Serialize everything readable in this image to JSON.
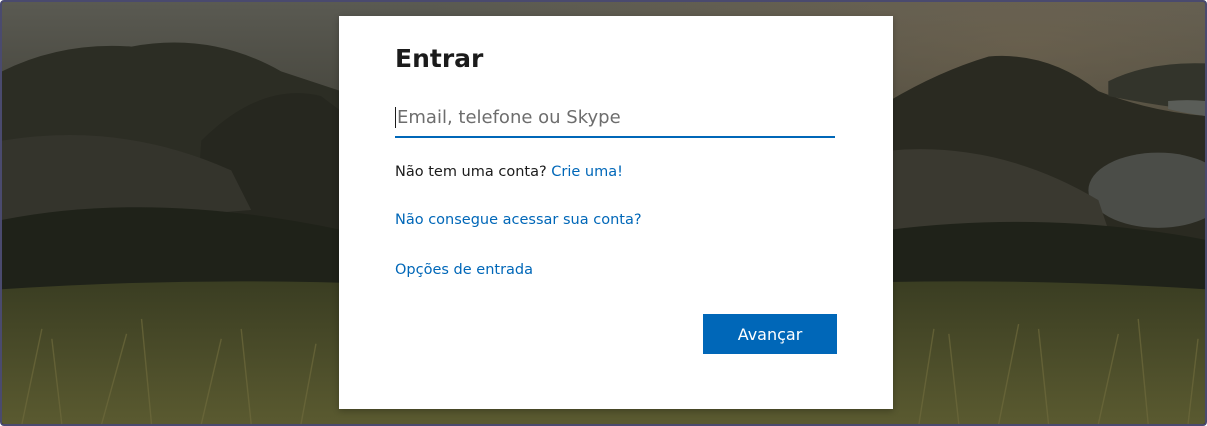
{
  "colors": {
    "accent": "#0067b8",
    "card_background": "#ffffff",
    "text": "#1b1b1b",
    "placeholder": "#6d6d6d"
  },
  "signin": {
    "title": "Entrar",
    "email_input": {
      "value": "",
      "placeholder": "Email, telefone ou Skype"
    },
    "no_account_text": "Não tem uma conta?",
    "create_account_link": "Crie uma!",
    "cant_access_link": "Não consegue acessar sua conta?",
    "signin_options_link": "Opções de entrada",
    "next_button": "Avançar"
  },
  "background": {
    "description_icon": "mountain-landscape-photo"
  }
}
